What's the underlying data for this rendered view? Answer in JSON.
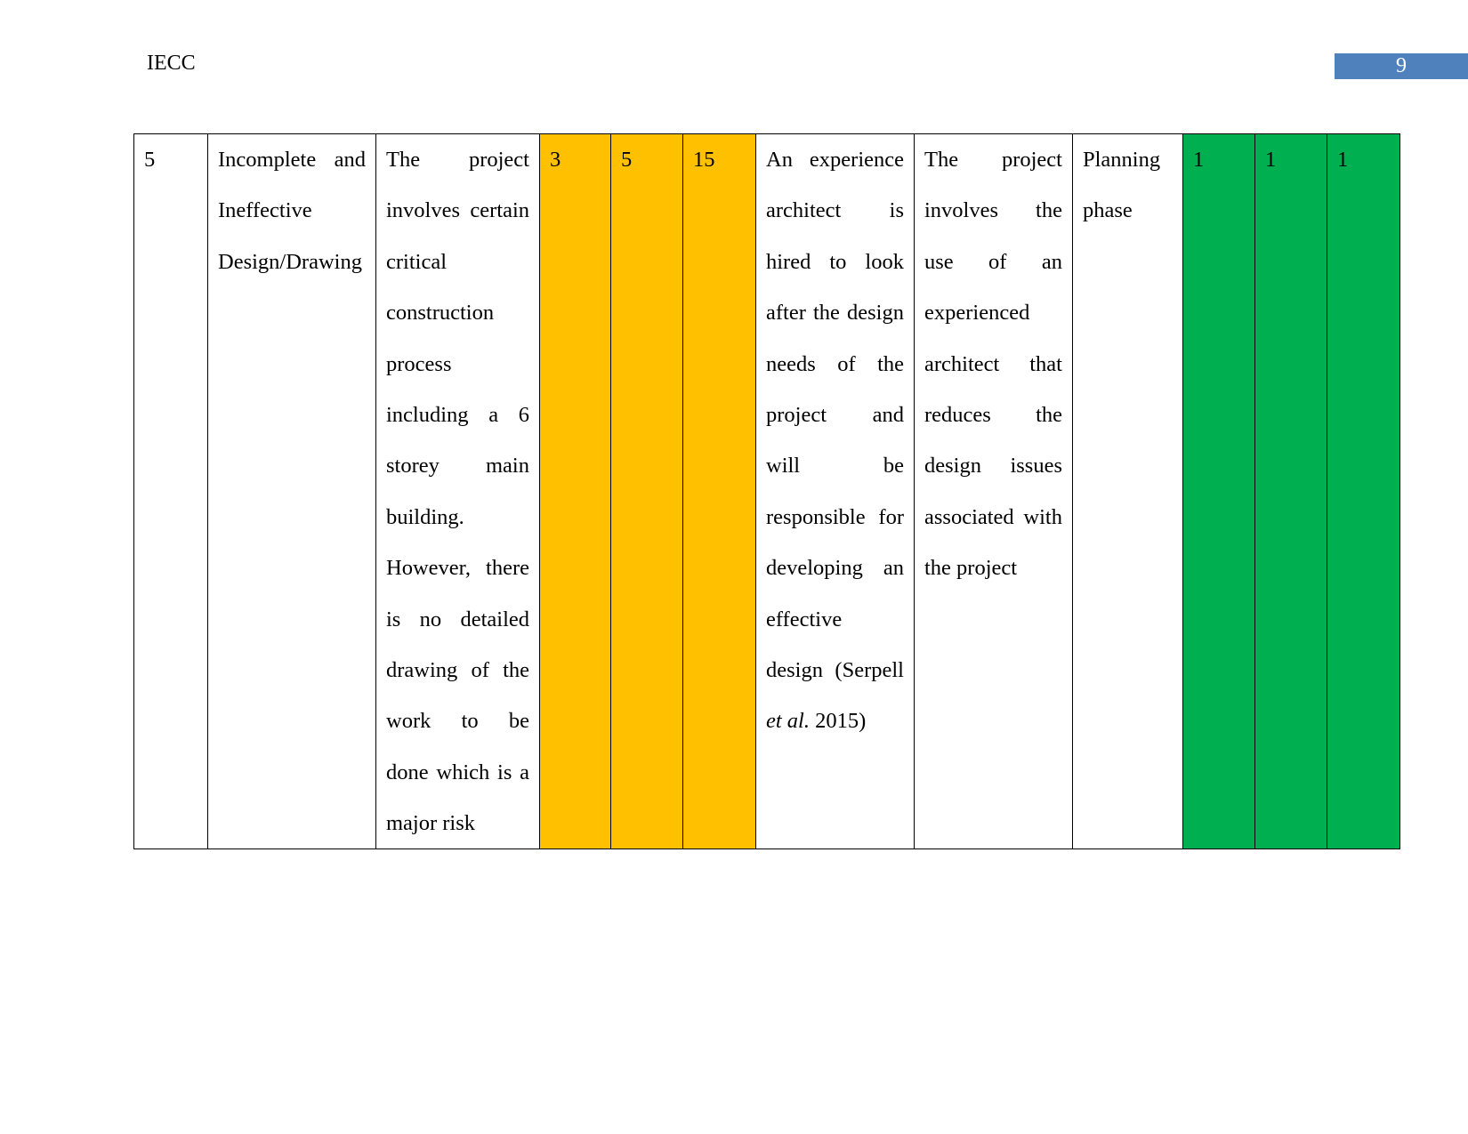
{
  "header": {
    "title": "IECC",
    "page_number": "9"
  },
  "row": {
    "no": "5",
    "risk": [
      "Incomplete and",
      "Ineffective",
      "Design/Drawing"
    ],
    "description": [
      "The project",
      "involves certain",
      "critical",
      "construction",
      "process",
      "including a 6",
      "storey main",
      "building.",
      "However, there",
      "is no detailed",
      "drawing of the",
      "work to be",
      "done which is a",
      "major risk"
    ],
    "likelihood": "3",
    "impact": "5",
    "score": "15",
    "mitigation": [
      "An experience",
      "architect is",
      "hired to look",
      "after the design",
      "needs of the",
      "project and",
      "will be",
      "responsible for",
      "developing an",
      "effective",
      "design (Serpell"
    ],
    "mitigation_last": {
      "italic": "et al.",
      "rest": " 2015)"
    },
    "justification": [
      "The project",
      "involves the",
      "use of an",
      "experienced",
      "architect that",
      "reduces the",
      "design issues",
      "associated with",
      "the project"
    ],
    "phase": [
      "Planning",
      "phase"
    ],
    "residual_likelihood": "1",
    "residual_impact": "1",
    "residual_score": "1"
  },
  "colors": {
    "amber": "#ffc000",
    "green": "#00b050",
    "header_bar": "#4f81bd"
  }
}
